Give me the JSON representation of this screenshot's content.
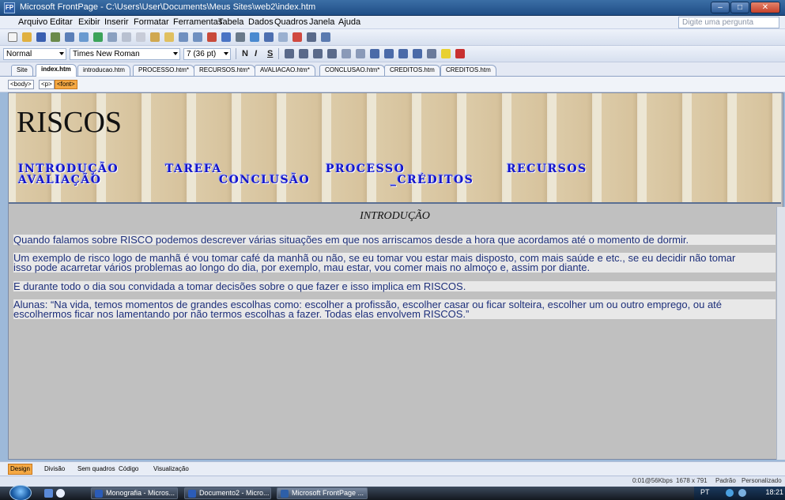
{
  "window": {
    "title": "Microsoft FrontPage - C:\\Users\\User\\Documents\\Meus Sites\\web2\\index.htm",
    "min": "–",
    "max": "□",
    "close": "✕"
  },
  "menu": {
    "items": [
      "Arquivo",
      "Editar",
      "Exibir",
      "Inserir",
      "Formatar",
      "Ferramentas",
      "Tabela",
      "Dados",
      "Quadros",
      "Janela",
      "Ajuda"
    ],
    "ask_placeholder": "Digite uma pergunta"
  },
  "format_bar": {
    "style": "Normal",
    "font": "Times New Roman",
    "size": "7 (36 pt)",
    "bold": "N",
    "italic": "I",
    "underline": "S"
  },
  "tabs": [
    {
      "label": "Site"
    },
    {
      "label": "index.htm"
    },
    {
      "label": "introducao.htm"
    },
    {
      "label": "PROCESSO.htm*"
    },
    {
      "label": "RECURSOS.htm*"
    },
    {
      "label": "AVALIACAO.htm*"
    },
    {
      "label": "CONCLUSAO.htm*"
    },
    {
      "label": "CREDITOS.htm"
    },
    {
      "label": "CREDITOS.htm"
    }
  ],
  "quick_tags": [
    "<body>",
    "<p>",
    "<font>"
  ],
  "banner": {
    "title": "RISCOS",
    "nav": {
      "introducao": "INTRODUÇÃO",
      "tarefa": "TAREFA",
      "processo": "PROCESSO",
      "recursos": "RECURSOS",
      "avaliacao": "AVALIAÇÃO",
      "conclusao": "CONCLUSÃO",
      "creditos": "_CRÉDITOS"
    }
  },
  "content": {
    "heading": "INTRODUÇÃO",
    "p1": "Quando falamos sobre RISCO podemos descrever várias situações em que nos arriscamos desde a hora que acordamos até o momento de dormir.",
    "p2a": "Um exemplo de risco logo de manhã é vou tomar café da manhã ou não, se eu tomar vou estar mais disposto, com mais saúde e etc., se eu decidir não tomar",
    "p2b": "isso pode acarretar vários problemas ao longo do dia, por exemplo, mau estar, vou comer mais no almoço e, assim por diante.",
    "p3": "E durante todo o dia sou convidada a tomar decisões sobre o que fazer e isso implica em RISCOS.",
    "p4a": "Alunas: “Na vida, temos momentos de grandes escolhas como: escolher a profissão, escolher casar ou ficar solteira, escolher um ou outro emprego, ou até",
    "p4b": "escolhermos ficar nos lamentando por não termos escolhas a fazer. Todas elas envolvem RISCOS.”"
  },
  "views": {
    "design": "Design",
    "split": "Divisão",
    "noframes": "Sem quadros",
    "code": "Código",
    "preview": "Visualização"
  },
  "status": {
    "speed": "0:01@56Kbps",
    "dimensions": "1678 x 791",
    "mode": "Padrão",
    "custom": "Personalizado"
  },
  "taskbar": {
    "tasks": [
      "Monografia - Micros...",
      "Documento2 - Micro...",
      "Microsoft FrontPage ..."
    ],
    "lang": "PT",
    "clock": "18:21"
  },
  "colors": {
    "nav_text": "#1515c8",
    "paragraph_text": "#1d2f7a",
    "page_bg": "#c0c0c0"
  }
}
